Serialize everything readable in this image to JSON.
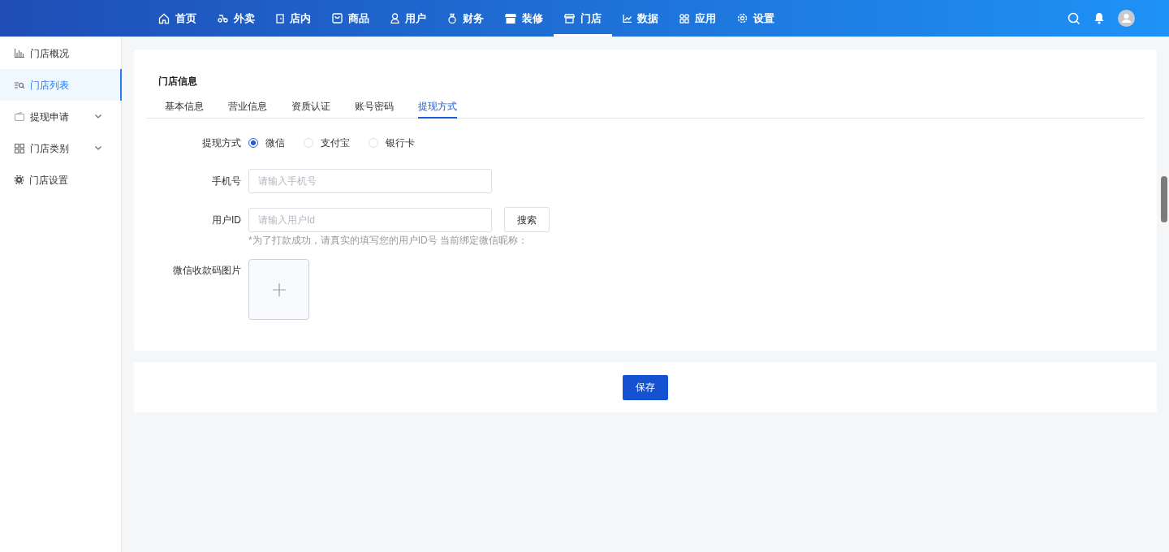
{
  "top_nav": {
    "items": [
      {
        "label": "首页",
        "selected": false
      },
      {
        "label": "外卖",
        "selected": false
      },
      {
        "label": "店内",
        "selected": false
      },
      {
        "label": "商品",
        "selected": false
      },
      {
        "label": "用户",
        "selected": false
      },
      {
        "label": "财务",
        "selected": false
      },
      {
        "label": "装修",
        "selected": false
      },
      {
        "label": "门店",
        "selected": true
      },
      {
        "label": "数据",
        "selected": false
      },
      {
        "label": "应用",
        "selected": false
      },
      {
        "label": "设置",
        "selected": false
      }
    ]
  },
  "sidebar": {
    "items": [
      {
        "label": "门店概况",
        "selected": false,
        "expandable": false
      },
      {
        "label": "门店列表",
        "selected": true,
        "expandable": false
      },
      {
        "label": "提现申请",
        "selected": false,
        "expandable": true
      },
      {
        "label": "门店类别",
        "selected": false,
        "expandable": true
      },
      {
        "label": "门店设置",
        "selected": false,
        "expandable": false
      }
    ]
  },
  "card": {
    "title": "门店信息",
    "tabs": [
      {
        "label": "基本信息",
        "selected": false
      },
      {
        "label": "营业信息",
        "selected": false
      },
      {
        "label": "资质认证",
        "selected": false
      },
      {
        "label": "账号密码",
        "selected": false
      },
      {
        "label": "提现方式",
        "selected": true
      }
    ],
    "form": {
      "method": {
        "label": "提现方式",
        "options": [
          {
            "label": "微信",
            "selected": true
          },
          {
            "label": "支付宝",
            "selected": false
          },
          {
            "label": "银行卡",
            "selected": false
          }
        ]
      },
      "phone": {
        "label": "手机号",
        "placeholder": "请输入手机号"
      },
      "user_id": {
        "label": "用户ID",
        "placeholder": "请输入用户Id",
        "button": "搜索",
        "hint": "*为了打款成功，请真实的填写您的用户ID号 当前绑定微信昵称："
      },
      "qr_image": {
        "label": "微信收款码图片"
      }
    }
  },
  "save_button": "保存"
}
